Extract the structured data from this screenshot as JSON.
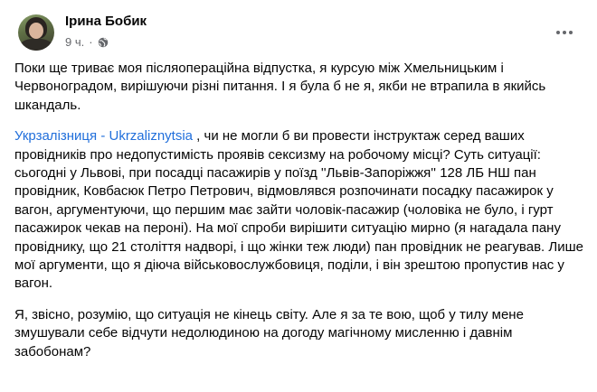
{
  "post": {
    "author": "Ірина Бобик",
    "time": "9 ч.",
    "separator": "·",
    "visibility_icon": "globe-icon",
    "more_icon": "more-horizontal-icon",
    "paragraph1": "Поки ще триває моя післяопераційна відпустка, я курсую між Хмельницьким і Червоноградом, вирішуючи різні питання. І я була б не я, якби не втрапила в якийсь шкандаль.",
    "mention": "Укрзалізниця - Ukrzaliznytsia",
    "paragraph2_rest": " , чи не могли б ви провести інструктаж серед ваших провідників про недопустимість проявів сексизму на робочому місці? Суть ситуації: сьогодні у Львові, при посадці пасажирів у поїзд ''Львів-Запоріжжя'' 128 ЛБ НШ пан провідник, Ковбасюк Петро Петрович, відмовлявся розпочинати посадку пасажирок у вагон, аргументуючи, що першим має зайти чоловік-пасажир (чоловіка не було, і гурт пасажирок чекав на пероні). На мої спроби вирішити ситуацію мирно (я нагадала пану провіднику, що 21 століття надворі, і що жінки теж люди) пан провідник не реагував. Лише мої аргументи, що я діюча військовослужбовиця, поділи, і він зрештою пропустив нас у вагон.",
    "paragraph3": "Я, звісно, розумію, що ситуація не кінець світу. Але я за те вою, щоб у тилу мене змушували себе відчути недолюдиною на догоду магічному мисленню і давнім забобонам?"
  },
  "colors": {
    "text": "#050505",
    "secondary": "#65676b",
    "link": "#216fdb",
    "background": "#ffffff"
  }
}
